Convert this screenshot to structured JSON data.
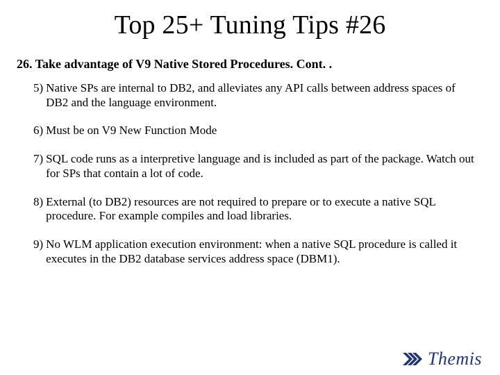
{
  "title": "Top 25+ Tuning Tips #26",
  "heading": "26. Take advantage of V9 Native Stored Procedures. Cont. .",
  "items": [
    {
      "n": "5)",
      "t": "Native SPs are internal to DB2, and alleviates any API calls between address spaces of DB2 and the language environment."
    },
    {
      "n": "6)",
      "t": "Must be on V9 New Function Mode"
    },
    {
      "n": "7)",
      "t": "SQL code runs as a interpretive language and is included as part of the package.  Watch out for SPs that contain a lot of code."
    },
    {
      "n": "8)",
      "t": "External (to DB2) resources are not required to prepare or to execute a native SQL procedure.  For example compiles and load libraries."
    },
    {
      "n": "9)",
      "t": "No WLM application execution environment: when a native SQL procedure is called it executes in the DB2 database services address space (DBM1)."
    }
  ],
  "logo": {
    "text": "Themis",
    "color": "#24366f"
  }
}
